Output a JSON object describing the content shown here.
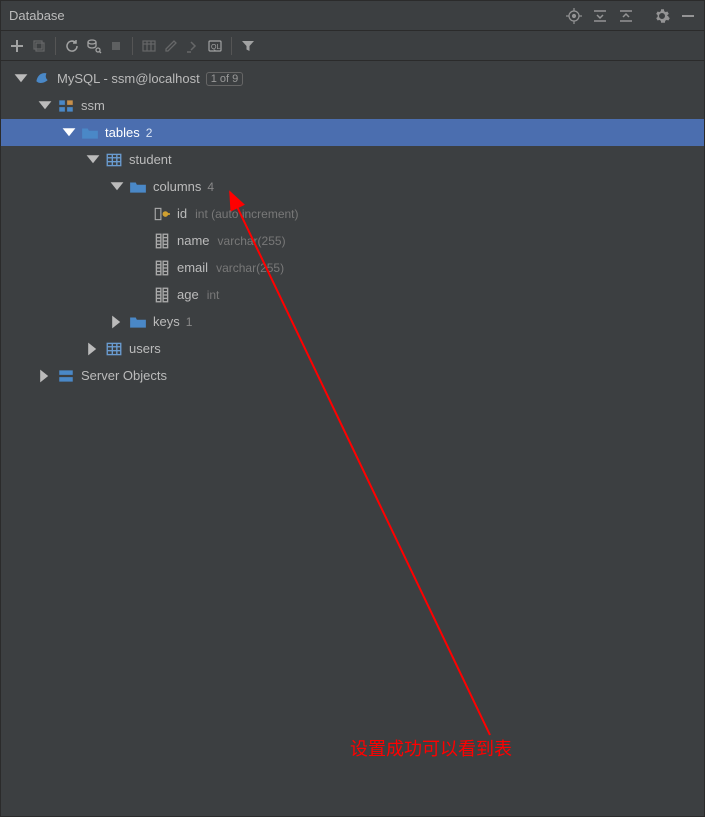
{
  "panel": {
    "title": "Database"
  },
  "tree": {
    "root": {
      "label": "MySQL - ssm@localhost",
      "badge": "1 of 9"
    },
    "schema": {
      "label": "ssm"
    },
    "tables": {
      "label": "tables",
      "count": "2"
    },
    "student": {
      "label": "student"
    },
    "columns": {
      "label": "columns",
      "count": "4"
    },
    "col_id": {
      "label": "id",
      "type": "int (auto increment)"
    },
    "col_name": {
      "label": "name",
      "type": "varchar(255)"
    },
    "col_email": {
      "label": "email",
      "type": "varchar(255)"
    },
    "col_age": {
      "label": "age",
      "type": "int"
    },
    "keys": {
      "label": "keys",
      "count": "1"
    },
    "users": {
      "label": "users"
    },
    "server_objects": {
      "label": "Server Objects"
    }
  },
  "annotation": {
    "text": "设置成功可以看到表"
  }
}
